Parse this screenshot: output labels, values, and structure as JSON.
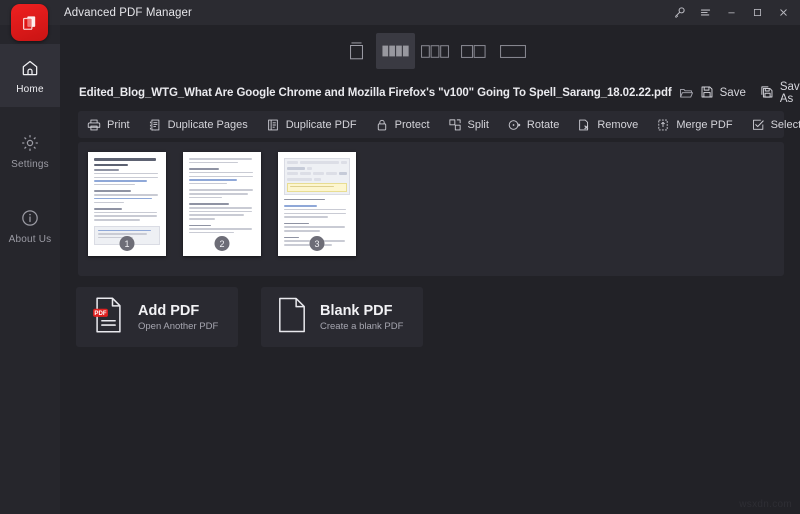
{
  "window": {
    "title": "Advanced PDF Manager",
    "logo_icon": "pdf-pages-logo",
    "controls": [
      {
        "name": "key-icon",
        "glyph": "key"
      },
      {
        "name": "menu-icon",
        "glyph": "hamburger"
      },
      {
        "name": "minimize-icon",
        "glyph": "minimize"
      },
      {
        "name": "maximize-icon",
        "glyph": "maximize"
      },
      {
        "name": "close-icon",
        "glyph": "close"
      }
    ]
  },
  "sidebar": {
    "items": [
      {
        "label": "Home",
        "icon": "home-icon",
        "active": true
      },
      {
        "label": "Settings",
        "icon": "gear-icon",
        "active": false
      },
      {
        "label": "About Us",
        "icon": "info-icon",
        "active": false
      }
    ]
  },
  "view_modes": {
    "selected_index": 1,
    "options": [
      {
        "name": "view-mode-single-scroll",
        "columns": 1,
        "style": "scroll"
      },
      {
        "name": "view-mode-four-column",
        "columns": 4,
        "style": "grid"
      },
      {
        "name": "view-mode-three-column",
        "columns": 3,
        "style": "grid"
      },
      {
        "name": "view-mode-two-column",
        "columns": 2,
        "style": "grid"
      },
      {
        "name": "view-mode-one-column",
        "columns": 1,
        "style": "grid"
      }
    ]
  },
  "file_bar": {
    "file_name": "Edited_Blog_WTG_What Are Google Chrome and Mozilla Firefox's \"v100\" Going To Spell_Sarang_18.02.22.pdf",
    "folder_icon": "folder-open-icon",
    "save_label": "Save",
    "save_icon": "floppy-save-icon",
    "save_as_label": "Save As",
    "save_as_icon": "floppy-save-as-icon",
    "close_icon": "close-circle-icon"
  },
  "toolbar": {
    "buttons": [
      {
        "label": "Print",
        "icon": "printer-icon"
      },
      {
        "label": "Duplicate Pages",
        "icon": "duplicate-pages-icon"
      },
      {
        "label": "Duplicate PDF",
        "icon": "duplicate-pdf-icon"
      },
      {
        "label": "Protect",
        "icon": "lock-icon"
      },
      {
        "label": "Split",
        "icon": "split-icon"
      },
      {
        "label": "Rotate",
        "icon": "rotate-icon"
      },
      {
        "label": "Remove",
        "icon": "remove-page-icon"
      },
      {
        "label": "Merge PDF",
        "icon": "merge-pdf-icon"
      },
      {
        "label": "Select All",
        "icon": "checkbox-check-icon"
      }
    ],
    "overflow_icon": "chevron-down-icon"
  },
  "thumbnails": {
    "pages": [
      {
        "number": "1"
      },
      {
        "number": "2"
      },
      {
        "number": "3"
      }
    ]
  },
  "cards": [
    {
      "title": "Add PDF",
      "subtitle": "Open Another PDF",
      "icon": "pdf-document-icon",
      "name": "add-pdf-card"
    },
    {
      "title": "Blank PDF",
      "subtitle": "Create a blank PDF",
      "icon": "blank-document-icon",
      "name": "blank-pdf-card"
    }
  ],
  "watermark": {
    "text": "wsxdn.com"
  },
  "colors": {
    "brand_red": "#ef2020",
    "window_bg": "#222227",
    "panel_bg": "#2a2a31",
    "titlebar_bg": "#2b2b31",
    "sidebar_bg": "#26262c",
    "sidebar_active": "#313139",
    "text_primary": "#eaeaee",
    "text_muted": "#a6a6b0"
  }
}
